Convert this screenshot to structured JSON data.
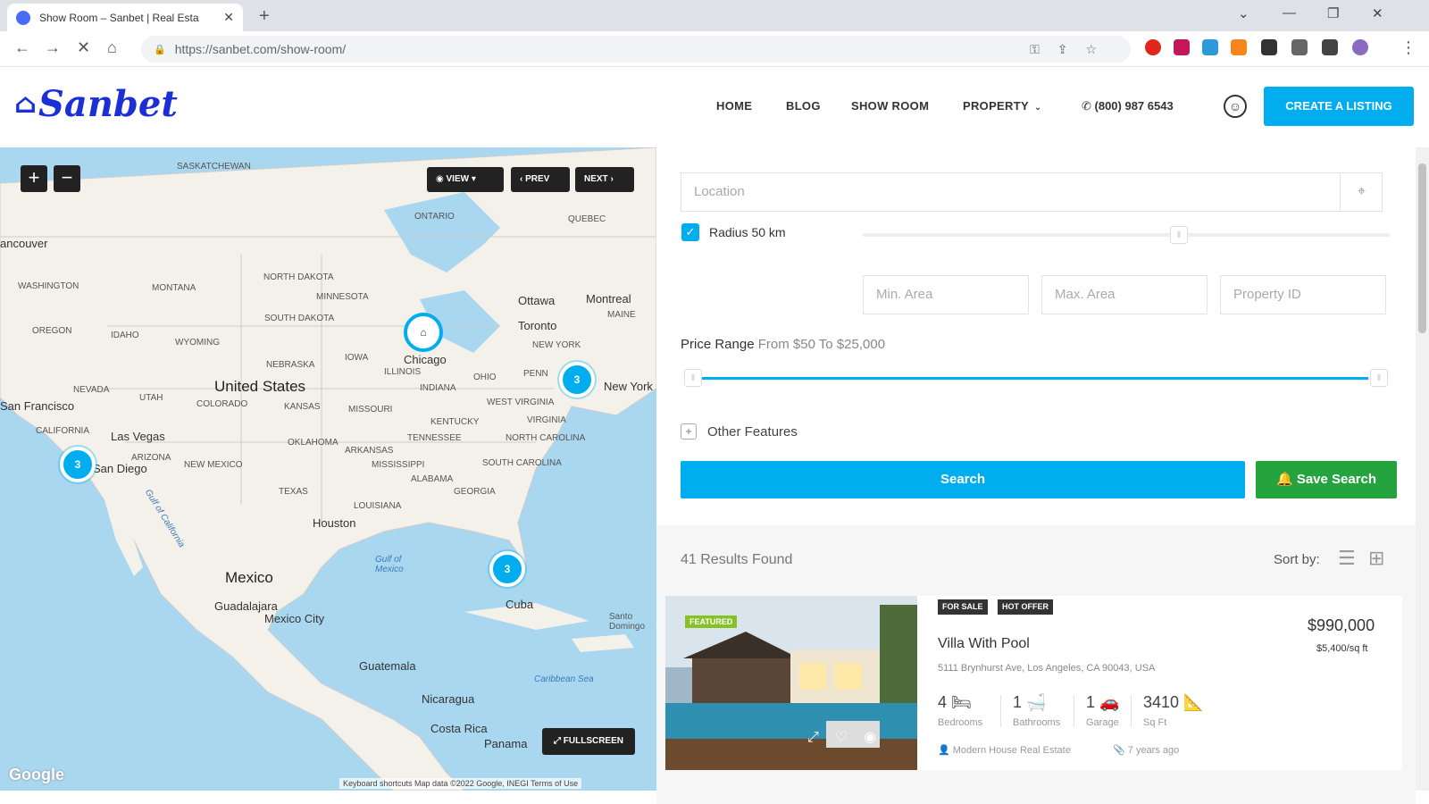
{
  "browser": {
    "tab_title": "Show Room – Sanbet | Real Esta",
    "url": "https://sanbet.com/show-room/"
  },
  "site": {
    "logo": "Sanbet",
    "nav": [
      "HOME",
      "BLOG",
      "SHOW ROOM",
      "PROPERTY"
    ],
    "phone": "(800) 987 6543",
    "create_listing": "CREATE A LISTING"
  },
  "map": {
    "controls": {
      "view": "VIEW",
      "prev": "PREV",
      "next": "NEXT",
      "fullscreen": "FULLSCREEN"
    },
    "clusters": [
      "3",
      "3",
      "3"
    ],
    "pin_label": "Chicago",
    "labels": {
      "united_states": "United States",
      "mexico": "Mexico",
      "cuba": "Cuba",
      "gulf": "Gulf of Mexico",
      "caribbean": "Caribbean Sea",
      "vancouver": "ancouver",
      "ottawa": "Ottawa",
      "montreal": "Montreal",
      "toronto": "Toronto",
      "new_york": "New York",
      "san_francisco": "San Francisco",
      "las_vegas": "Las Vegas",
      "san_diego": "San Diego",
      "houston": "Houston",
      "guadalajara": "Guadalajara",
      "mexico_city": "Mexico City",
      "guatemala": "Guatemala",
      "nicaragua": "Nicaragua",
      "costa_rica": "Costa Rica",
      "panama": "Panama",
      "santo_domingo": "Santo Domingo",
      "saskatchewan": "SASKATCHEWAN",
      "ontario": "ONTARIO",
      "quebec": "QUEBEC",
      "washington": "WASHINGTON",
      "montana": "MONTANA",
      "north_dakota": "NORTH DAKOTA",
      "minnesota": "MINNESOTA",
      "oregon": "OREGON",
      "idaho": "IDAHO",
      "wyoming": "WYOMING",
      "south_dakota": "SOUTH DAKOTA",
      "nebraska": "NEBRASKA",
      "iowa": "IOWA",
      "nevada": "NEVADA",
      "utah": "UTAH",
      "colorado": "COLORADO",
      "kansas": "KANSAS",
      "missouri": "MISSOURI",
      "illinois": "ILLINOIS",
      "indiana": "INDIANA",
      "ohio": "OHIO",
      "california": "CALIFORNIA",
      "arizona": "ARIZONA",
      "new_mexico": "NEW MEXICO",
      "texas": "TEXAS",
      "oklahoma": "OKLAHOMA",
      "arkansas": "ARKANSAS",
      "tennessee": "TENNESSEE",
      "kentucky": "KENTUCKY",
      "mississippi": "MISSISSIPPI",
      "alabama": "ALABAMA",
      "georgia": "GEORGIA",
      "louisiana": "LOUISIANA",
      "north_carolina": "NORTH CAROLINA",
      "south_carolina": "SOUTH CAROLINA",
      "virginia": "VIRGINIA",
      "west_virginia": "WEST VIRGINIA",
      "penn": "PENN",
      "maine": "MAINE",
      "gulf_california": "Gulf of California"
    },
    "google": "Google",
    "attribution": "Keyboard shortcuts   Map data ©2022 Google, INEGI   Terms of Use"
  },
  "search": {
    "location_placeholder": "Location",
    "radius_label": "Radius 50 km",
    "radius_checked": true,
    "radius_level": 0.6,
    "min_area": "Min. Area",
    "max_area": "Max. Area",
    "property_id": "Property ID",
    "price_range_label": "Price Range",
    "price_from": "From $50 To $25,000",
    "other_features": "Other Features",
    "search_btn": "Search",
    "save_search_btn": "Save Search"
  },
  "results": {
    "count": "41 Results Found",
    "sort_by": "Sort by:"
  },
  "listing": {
    "badge": "FEATURED",
    "tags": [
      "FOR SALE",
      "HOT OFFER"
    ],
    "title": "Villa With Pool",
    "address": "5111 Brynhurst Ave, Los Angeles, CA 90043, USA",
    "price": "$990,000",
    "price_per_sqft": "$5,400/sq ft",
    "stats": [
      {
        "value": "4",
        "label": "Bedrooms"
      },
      {
        "value": "1",
        "label": "Bathrooms"
      },
      {
        "value": "1",
        "label": "Garage"
      },
      {
        "value": "3410",
        "label": "Sq Ft"
      }
    ],
    "agent": "Modern House Real Estate",
    "posted": "7 years ago"
  },
  "colors": {
    "accent": "#00aeef",
    "save": "#24a33e",
    "logo": "#1b2fd6"
  }
}
